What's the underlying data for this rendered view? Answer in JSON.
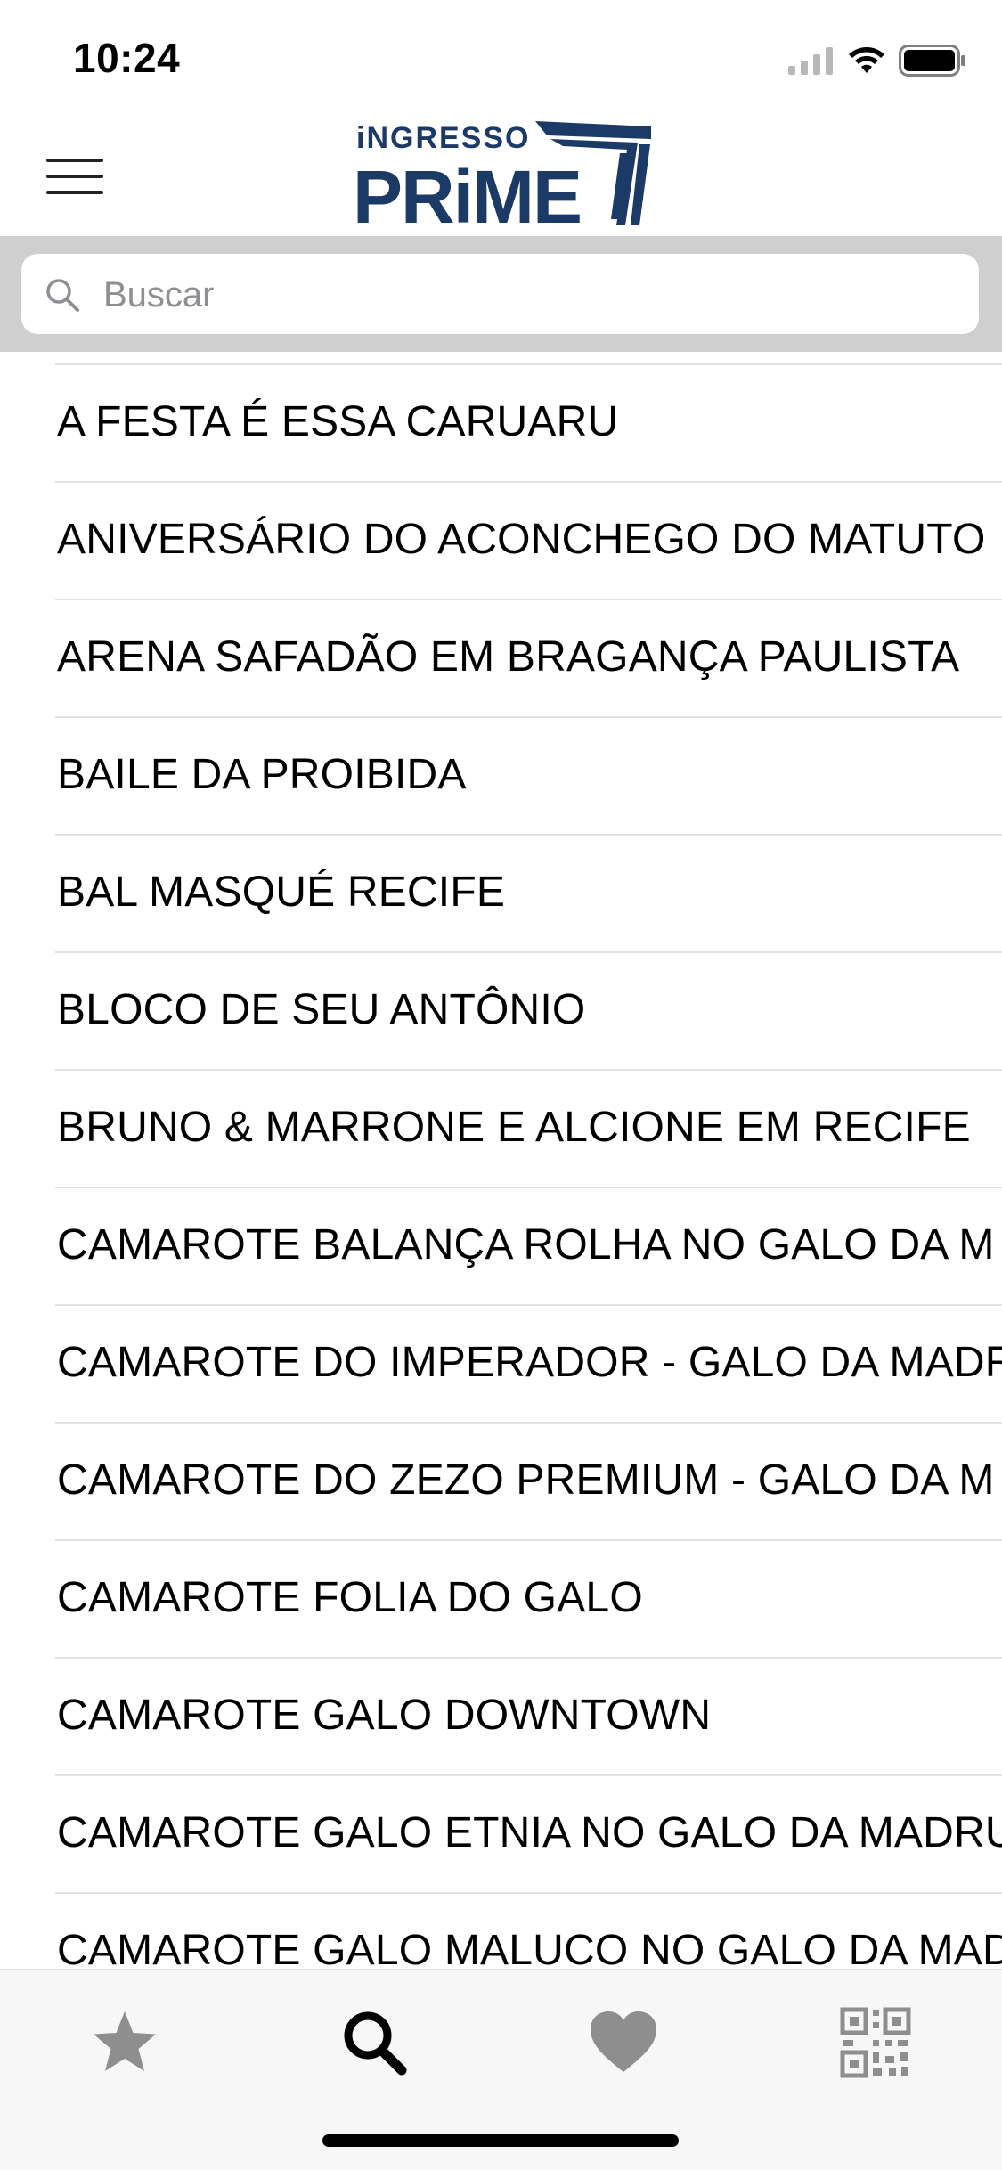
{
  "status_bar": {
    "time": "10:24",
    "icons": [
      "cellular-signal-icon",
      "wifi-icon",
      "battery-icon"
    ]
  },
  "header": {
    "menu_icon": "hamburger-menu-icon",
    "logo_top": "iNGRESSO",
    "logo_bottom": "PRiME",
    "brand_color": "#1b3a66"
  },
  "search": {
    "placeholder": "Buscar",
    "value": "",
    "icon": "search-icon"
  },
  "events": [
    "A FESTA É ESSA CARUARU",
    "ANIVERSÁRIO DO ACONCHEGO DO MATUTO",
    "ARENA SAFADÃO EM BRAGANÇA PAULISTA",
    "BAILE DA PROIBIDA",
    "BAL MASQUÉ RECIFE",
    "BLOCO DE SEU ANTÔNIO",
    "BRUNO & MARRONE E ALCIONE EM RECIFE",
    "CAMAROTE BALANÇA ROLHA NO GALO DA M",
    "CAMAROTE DO IMPERADOR - GALO DA MADR",
    "CAMAROTE DO ZEZO PREMIUM - GALO DA M",
    "CAMAROTE FOLIA DO GALO",
    "CAMAROTE GALO DOWNTOWN",
    "CAMAROTE GALO ETNIA NO GALO DA MADRU",
    "CAMAROTE GALO MALUCO NO GALO DA MAD"
  ],
  "tab_bar": {
    "tabs": [
      "star-icon",
      "search-icon",
      "heart-icon",
      "qr-code-icon"
    ],
    "selected_index": 1,
    "active_color": "#000000",
    "inactive_color": "#8e8e8e"
  }
}
